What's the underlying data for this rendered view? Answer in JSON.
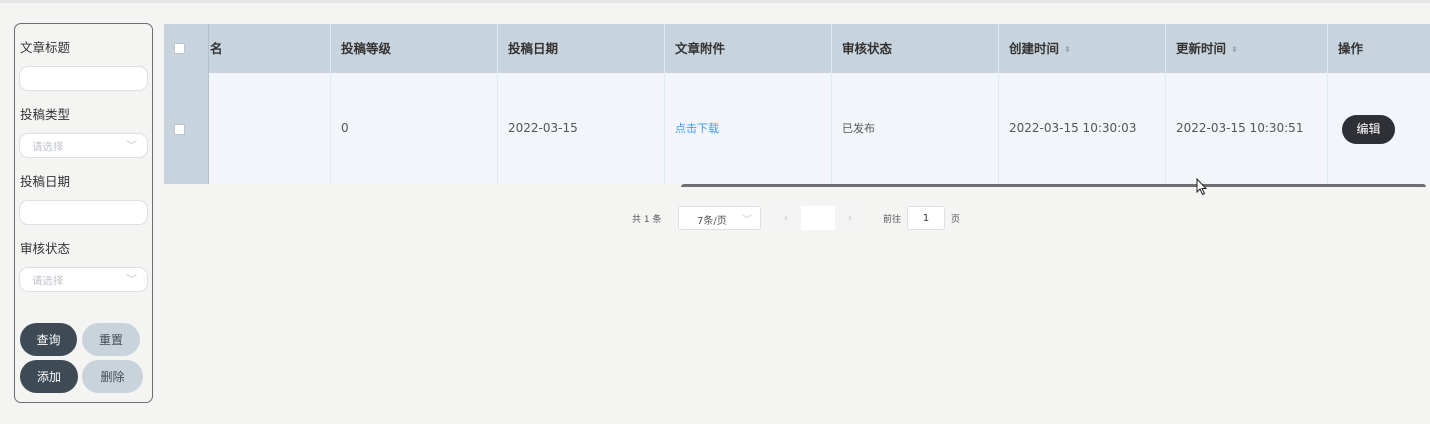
{
  "filters": {
    "title_label": "文章标题",
    "title_value": "",
    "type_label": "投稿类型",
    "type_placeholder": "请选择",
    "date_label": "投稿日期",
    "date_value": "",
    "status_label": "审核状态",
    "status_placeholder": "请选择"
  },
  "actions": {
    "query": "查询",
    "reset": "重置",
    "add": "添加",
    "delete": "删除"
  },
  "table": {
    "columns": [
      "名",
      "投稿等级",
      "投稿日期",
      "文章附件",
      "审核状态",
      "创建时间",
      "更新时间",
      "操作"
    ],
    "sortable_icon": "sort-caret-icon",
    "rows": [
      {
        "name": "",
        "level": "0",
        "date": "2022-03-15",
        "attachment": "点击下载",
        "status": "已发布",
        "created": "2022-03-15 10:30:03",
        "updated": "2022-03-15 10:30:51",
        "edit": "编辑"
      }
    ]
  },
  "pagination": {
    "total": "共 1 条",
    "page_size": "7条/页",
    "goto_prefix": "前往",
    "goto_value": "1",
    "goto_suffix": "页"
  },
  "colors": {
    "header_bg": "#c8d4dd",
    "row_bg": "#f2f5f9",
    "dark_button": "#3e4b55",
    "light_button": "#c9d3db",
    "link": "#409eff"
  }
}
